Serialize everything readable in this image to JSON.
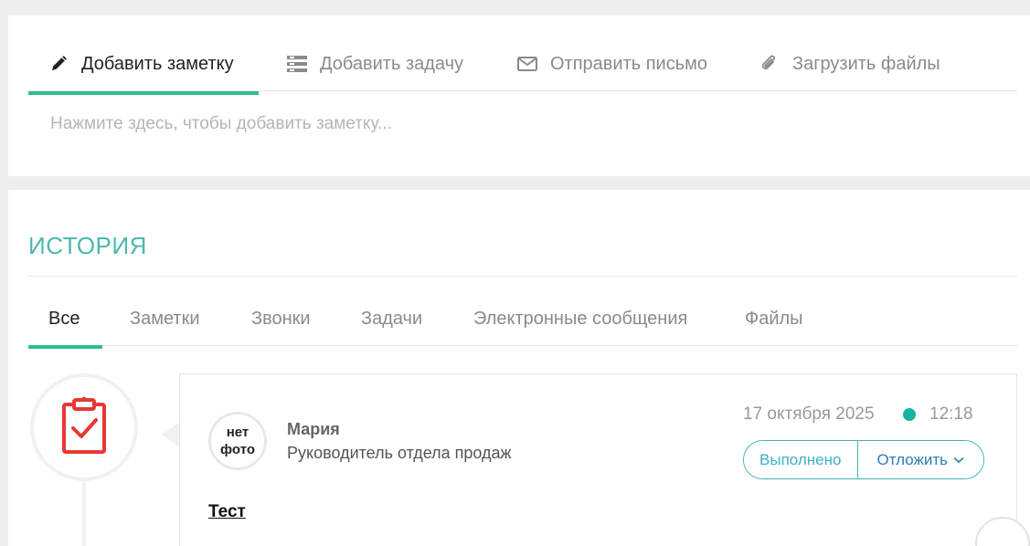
{
  "composer": {
    "tabs": [
      {
        "label": "Добавить заметку",
        "icon": "pencil-icon"
      },
      {
        "label": "Добавить задачу",
        "icon": "task-list-icon"
      },
      {
        "label": "Отправить письмо",
        "icon": "envelope-icon"
      },
      {
        "label": "Загрузить файлы",
        "icon": "paperclip-icon"
      }
    ],
    "active_tab": 0,
    "placeholder": "Нажмите здесь, чтобы добавить заметку..."
  },
  "history": {
    "title": "ИСТОРИЯ",
    "tabs": [
      "Все",
      "Заметки",
      "Звонки",
      "Задачи",
      "Электронные сообщения",
      "Файлы"
    ],
    "active_tab": 0,
    "entries": [
      {
        "type_icon": "clipboard-check-icon",
        "avatar": {
          "line1": "нет",
          "line2": "фото"
        },
        "author": "Мария",
        "role": "Руководитель отдела продаж",
        "date": "17 октября 2025",
        "time": "12:18",
        "status_color": "#17b2a3",
        "done_label": "Выполнено",
        "postpone_label": "Отложить",
        "title": "Тест"
      }
    ]
  },
  "colors": {
    "accent_green": "#2fbe86",
    "history_title": "#4cb8ae",
    "task_icon_red": "#e53935",
    "button_border": "#3fb5b8"
  }
}
